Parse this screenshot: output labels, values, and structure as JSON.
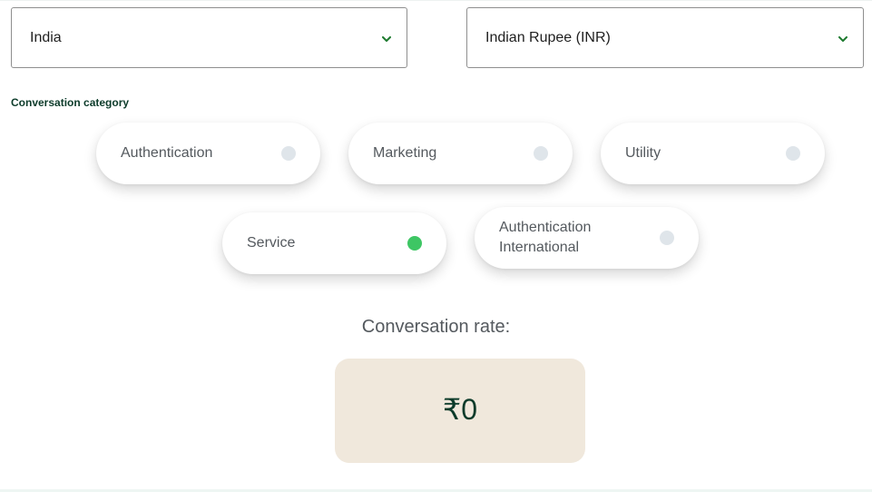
{
  "country_select": {
    "value": "India",
    "icon": "chevron-down-icon"
  },
  "currency_select": {
    "value": "Indian Rupee (INR)",
    "icon": "chevron-down-icon"
  },
  "category": {
    "label": "Conversation category",
    "options": [
      {
        "label": "Authentication",
        "selected": false
      },
      {
        "label": "Marketing",
        "selected": false
      },
      {
        "label": "Utility",
        "selected": false
      },
      {
        "label": "Service",
        "selected": true
      },
      {
        "label": "Authentication International",
        "selected": false
      }
    ]
  },
  "rate": {
    "title": "Conversation rate:",
    "value": "₹0"
  },
  "colors": {
    "accent_green": "#3ec664",
    "chevron_green": "#1e7b2f",
    "radio_unselected": "#dfe5ea",
    "rate_box_bg": "#f0e8dc",
    "dark_green_text": "#0c3b2a"
  }
}
